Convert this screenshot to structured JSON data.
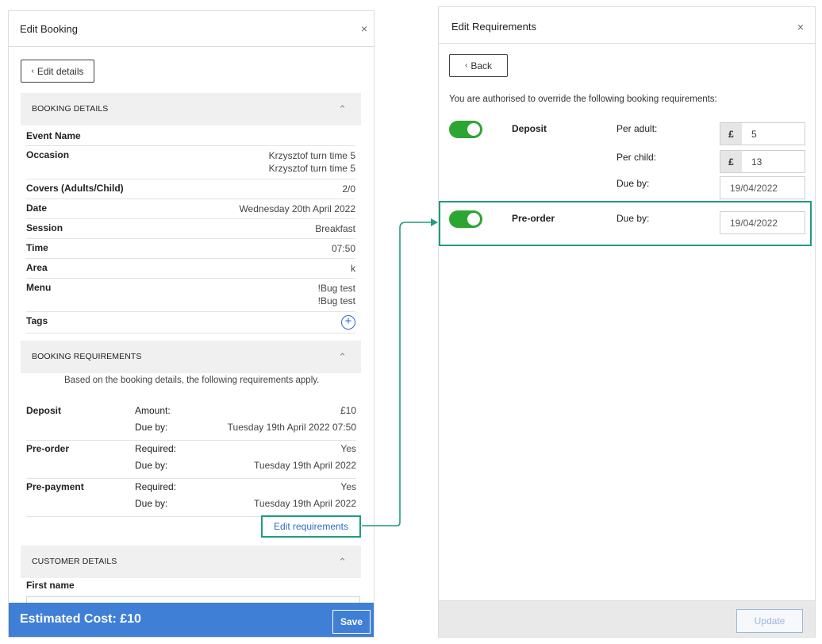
{
  "edit_booking": {
    "title": "Edit Booking",
    "close": "×",
    "edit_details_label": "Edit details",
    "booking_details_heading": "BOOKING DETAILS",
    "details": [
      {
        "label": "Event Name",
        "value": ""
      },
      {
        "label": "Occasion",
        "value": "Krzysztof turn time 5",
        "value2": "Krzysztof turn time 5"
      },
      {
        "label": "Covers (Adults/Child)",
        "value": "2/0"
      },
      {
        "label": "Date",
        "value": "Wednesday 20th April 2022"
      },
      {
        "label": "Session",
        "value": "Breakfast"
      },
      {
        "label": "Time",
        "value": "07:50"
      },
      {
        "label": "Area",
        "value": "k"
      },
      {
        "label": "Menu",
        "value": "!Bug test",
        "value2": "!Bug test"
      },
      {
        "label": "Tags",
        "value": ""
      }
    ],
    "booking_requirements_heading": "BOOKING REQUIREMENTS",
    "requirements_intro": "Based on the booking details, the following requirements apply.",
    "requirements": [
      {
        "name": "Deposit",
        "label1": "Amount:",
        "value1": "£10",
        "label2": "Due by:",
        "value2": "Tuesday 19th April 2022 07:50"
      },
      {
        "name": "Pre-order",
        "label1": "Required:",
        "value1": "Yes",
        "label2": "Due by:",
        "value2": "Tuesday 19th April 2022"
      },
      {
        "name": "Pre-payment",
        "label1": "Required:",
        "value1": "Yes",
        "label2": "Due by:",
        "value2": "Tuesday 19th April 2022"
      }
    ],
    "edit_requirements_label": "Edit requirements",
    "customer_details_heading": "CUSTOMER DETAILS",
    "first_name_label": "First name",
    "estimated_cost": "Estimated Cost: £10",
    "save_label": "Save"
  },
  "edit_requirements": {
    "title": "Edit Requirements",
    "close": "×",
    "back_label": "Back",
    "override_text": "You are authorised to override the following booking requirements:",
    "deposit": {
      "name": "Deposit",
      "enabled": true,
      "per_adult_label": "Per adult:",
      "per_adult_currency": "£",
      "per_adult_value": "5",
      "per_child_label": "Per child:",
      "per_child_currency": "£",
      "per_child_value": "13",
      "due_by_label": "Due by:",
      "due_by_value": "19/04/2022"
    },
    "preorder": {
      "name": "Pre-order",
      "enabled": true,
      "due_by_label": "Due by:",
      "due_by_value": "19/04/2022"
    },
    "update_label": "Update"
  },
  "colors": {
    "footer_blue": "#3f7fd6",
    "highlight_green": "#1f9c7f",
    "toggle_green": "#2da532",
    "link_blue": "#2c6bc8"
  }
}
